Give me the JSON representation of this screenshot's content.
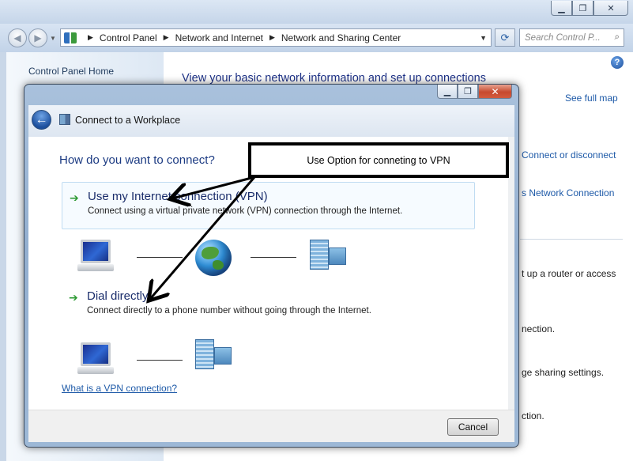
{
  "explorer": {
    "address_crumbs": [
      "Control Panel",
      "Network and Internet",
      "Network and Sharing Center"
    ],
    "search_placeholder": "Search Control P...",
    "left_pane": {
      "home_link": "Control Panel Home"
    },
    "heading": "View your basic network information and set up connections",
    "links": {
      "see_full_map": "See full map",
      "connect_or_disconnect": "Connect or disconnect",
      "network_connection": "s Network Connection"
    },
    "texts": {
      "router_access": "t up a router or access",
      "nection": "nection.",
      "sharing_settings": "ge sharing settings.",
      "ction": "ction."
    }
  },
  "dialog": {
    "title": "Connect to a Workplace",
    "question": "How do you want to connect?",
    "options": [
      {
        "title": "Use my Internet connection (VPN)",
        "description": "Connect using a virtual private network (VPN) connection through the Internet."
      },
      {
        "title": "Dial directly",
        "description": "Connect directly to a phone number without going through the Internet."
      }
    ],
    "help_link": "What is a VPN connection?",
    "cancel_label": "Cancel"
  },
  "annotation": {
    "callout_text": "Use Option for conneting to VPN"
  },
  "colors": {
    "link": "#1e5aa8",
    "heading": "#1e3287",
    "option_title": "#1a2d6b",
    "option_arrow": "#2e9a34",
    "dialog_frame": "#9db8d6"
  }
}
